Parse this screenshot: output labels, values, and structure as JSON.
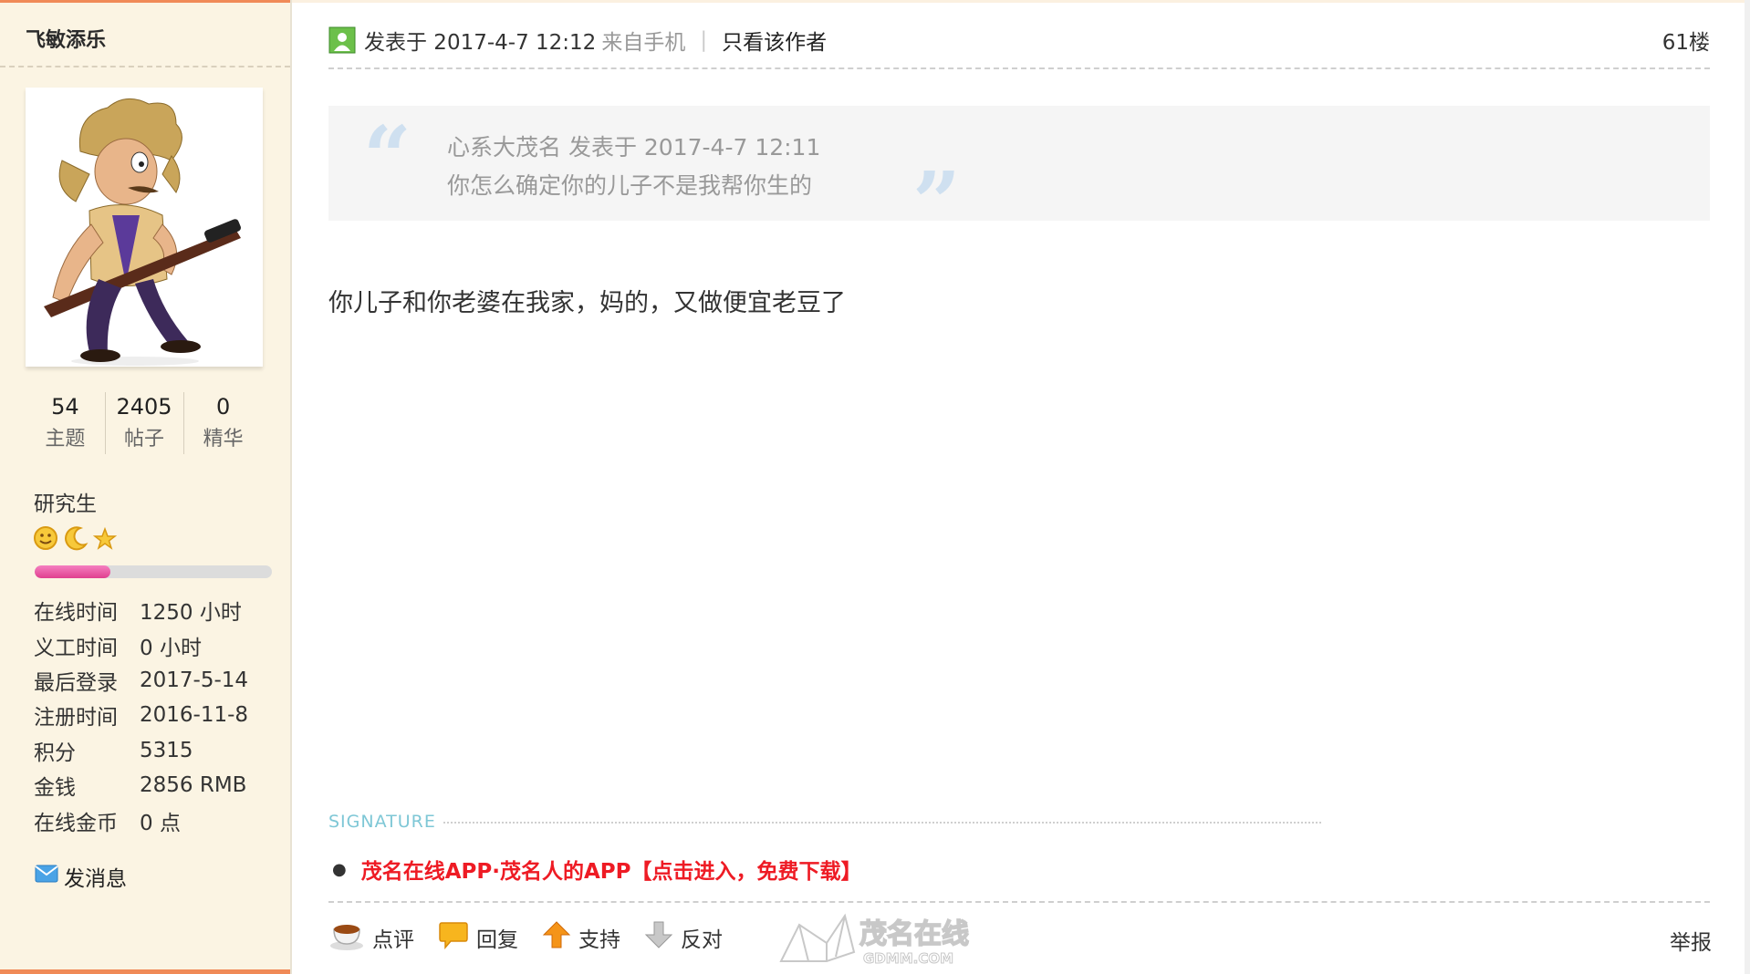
{
  "user": {
    "name": "飞敏添乐",
    "stats": [
      {
        "value": "54",
        "label": "主题"
      },
      {
        "value": "2405",
        "label": "帖子"
      },
      {
        "value": "0",
        "label": "精华"
      }
    ],
    "rank": "研究生",
    "rank_icons": [
      "smiley-icon",
      "moon-icon",
      "star-icon"
    ],
    "progress_fraction": 0.32,
    "info": [
      {
        "key": "在线时间",
        "value": "1250 小时"
      },
      {
        "key": "义工时间",
        "value": "0 小时"
      },
      {
        "key": "最后登录",
        "value": "2017-5-14"
      },
      {
        "key": "注册时间",
        "value": "2016-11-8"
      },
      {
        "key": "积分",
        "value": "5315"
      },
      {
        "key": "金钱",
        "value": "2856 RMB"
      },
      {
        "key": "在线金币",
        "value": "0 点"
      }
    ],
    "send_message": "发消息"
  },
  "post": {
    "time": "发表于 2017-4-7 12:12",
    "from": "来自手机",
    "separator": "|",
    "only_author": "只看该作者",
    "floor": "61楼",
    "quote": {
      "author_line": "心系大茂名 发表于 2017-4-7 12:11",
      "text": "你怎么确定你的儿子不是我帮你生的"
    },
    "body": "你儿子和你老婆在我家，妈的，又做便宜老豆了",
    "signature_label": "SIGNATURE",
    "signature_link": "茂名在线APP·茂名人的APP【点击进入，免费下载】",
    "actions": {
      "comment": "点评",
      "reply": "回复",
      "support": "支持",
      "oppose": "反对"
    },
    "report": "举报",
    "watermark_text": "茂名在线",
    "watermark_sub": "GDMM.COM"
  },
  "colors": {
    "accent": "#f08a57",
    "signature_red": "#ee1b24",
    "progress_pink": "#e0408f",
    "sidebar_bg": "#fbf4e3"
  }
}
